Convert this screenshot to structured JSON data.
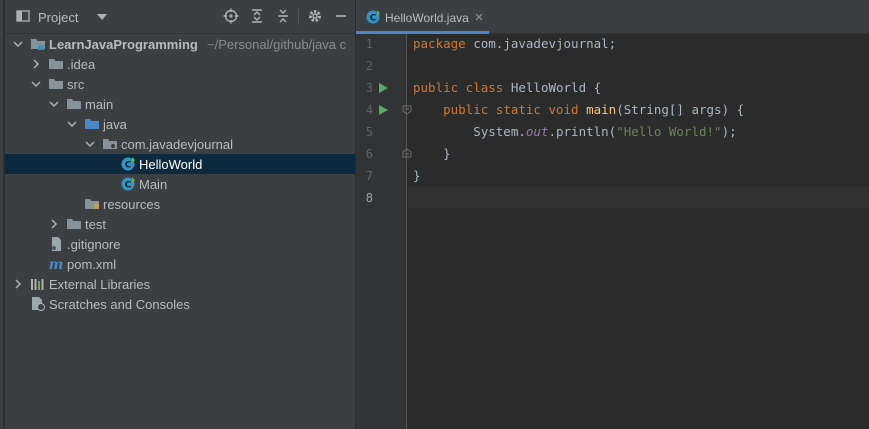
{
  "project_panel": {
    "title": "Project",
    "header_icons": [
      "locate-icon",
      "expand-all-icon",
      "collapse-all-icon",
      "gear-icon",
      "hide-icon"
    ],
    "tree": [
      {
        "label": "LearnJavaProgramming",
        "sub": "~/Personal/github/java c",
        "icon": "module-folder-icon",
        "depth": 0,
        "expanded": true
      },
      {
        "label": ".idea",
        "icon": "folder-icon",
        "depth": 1,
        "expanded": false
      },
      {
        "label": "src",
        "icon": "folder-icon",
        "depth": 1,
        "expanded": true
      },
      {
        "label": "main",
        "icon": "folder-icon",
        "depth": 2,
        "expanded": true
      },
      {
        "label": "java",
        "icon": "source-folder-icon",
        "depth": 3,
        "expanded": true
      },
      {
        "label": "com.javadevjournal",
        "icon": "package-icon",
        "depth": 4,
        "expanded": true
      },
      {
        "label": "HelloWorld",
        "icon": "java-class-icon",
        "depth": 5,
        "selected": true
      },
      {
        "label": "Main",
        "icon": "java-class-icon",
        "depth": 5
      },
      {
        "label": "resources",
        "icon": "resources-folder-icon",
        "depth": 3
      },
      {
        "label": "test",
        "icon": "folder-icon",
        "depth": 2,
        "expanded": false
      },
      {
        "label": ".gitignore",
        "icon": "gitignore-file-icon",
        "depth": 1
      },
      {
        "label": "pom.xml",
        "icon": "maven-file-icon",
        "depth": 1
      },
      {
        "label": "External Libraries",
        "icon": "libraries-icon",
        "depth": 0,
        "expanded": false
      },
      {
        "label": "Scratches and Consoles",
        "icon": "scratches-icon",
        "depth": 0
      }
    ]
  },
  "editor": {
    "tab": {
      "label": "HelloWorld.java",
      "icon": "java-class-icon"
    },
    "line_numbers": [
      "1",
      "2",
      "3",
      "4",
      "5",
      "6",
      "7",
      "8"
    ],
    "current_line": "8",
    "code": {
      "l1": {
        "kw": "package",
        "rest": " com.javadevjournal;"
      },
      "l3": {
        "kw": "public class",
        "rest": " HelloWorld {"
      },
      "l4": {
        "indent": "    ",
        "kw": "public static void",
        "sp": " ",
        "fn": "main",
        "rest": "(String[] args) {"
      },
      "l5": {
        "pre": "        System.",
        "field": "out",
        "mid": ".println(",
        "str": "\"Hello World!\"",
        "end": ");"
      },
      "l6": {
        "text": "    }"
      },
      "l7": {
        "text": "}"
      }
    }
  },
  "colors": {
    "panel_bg": "#3c3f41",
    "editor_bg": "#2b2b2b",
    "selection": "#0d293e",
    "keyword": "#cc7832",
    "method": "#ffc66d",
    "string": "#6a8759",
    "static_field": "#9876aa",
    "tab_underline": "#4a88c7"
  }
}
